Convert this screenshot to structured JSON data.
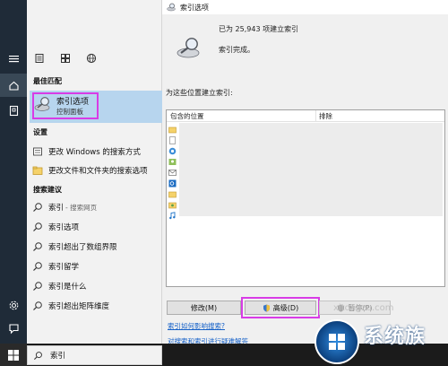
{
  "start_menu": {
    "toolbar": {
      "icons": [
        "document-icon",
        "web-icon"
      ]
    },
    "best_match": {
      "heading": "最佳匹配",
      "title": "索引选项",
      "subtitle": "控制面板"
    },
    "settings": {
      "heading": "设置",
      "items": [
        {
          "label": "更改 Windows 的搜索方式"
        },
        {
          "label": "更改文件和文件夹的搜索选项"
        }
      ]
    },
    "suggestions": {
      "heading": "搜索建议",
      "items": [
        {
          "label": "索引",
          "suffix": "- 搜索网页"
        },
        {
          "label": "索引选项"
        },
        {
          "label": "索引超出了数组界限"
        },
        {
          "label": "索引留学"
        },
        {
          "label": "索引是什么"
        },
        {
          "label": "索引超出矩阵维度"
        }
      ]
    }
  },
  "taskbar": {
    "search_value": "索引"
  },
  "indexing_window": {
    "title": "索引选项",
    "status_count": "已为 25,943 项建立索引",
    "status_done": "索引完成。",
    "list_label": "为这些位置建立索引:",
    "columns": {
      "included": "包含的位置",
      "exclude": "排除"
    },
    "buttons": {
      "modify": "修改(M)",
      "advanced": "高级(D)",
      "pause": "暂停(P)"
    },
    "links": {
      "how_index": "索引如何影响搜索?",
      "troubleshoot": "对搜索和索引进行疑难解答"
    }
  },
  "watermark": {
    "brand": "系统族",
    "url": "xitongzu.com"
  },
  "colors": {
    "highlight_frame": "#d83ce6",
    "best_match_bg": "#b7d5ee",
    "rail_bg": "#1f2b38",
    "link": "#1460c8"
  }
}
